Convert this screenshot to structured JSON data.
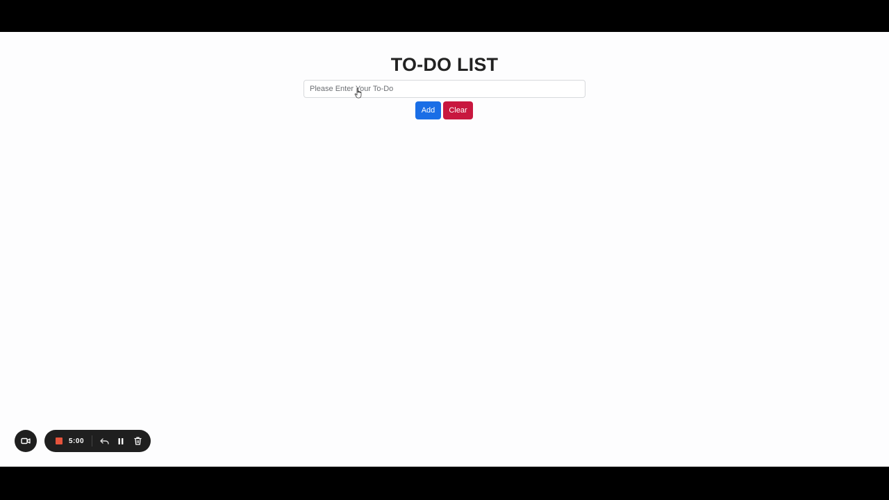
{
  "app": {
    "title": "TO-DO LIST"
  },
  "form": {
    "input_placeholder": "Please Enter Your To-Do",
    "input_value": "",
    "add_label": "Add",
    "clear_label": "Clear"
  },
  "recorder": {
    "timer": "5:00",
    "icons": [
      "video-camera-icon",
      "stop-icon",
      "undo-icon",
      "pause-icon",
      "trash-icon"
    ]
  },
  "colors": {
    "add_button": "#1a6ee6",
    "clear_button": "#c8173f",
    "recorder_bg": "#1f1f1f",
    "stop": "#e5533c"
  }
}
